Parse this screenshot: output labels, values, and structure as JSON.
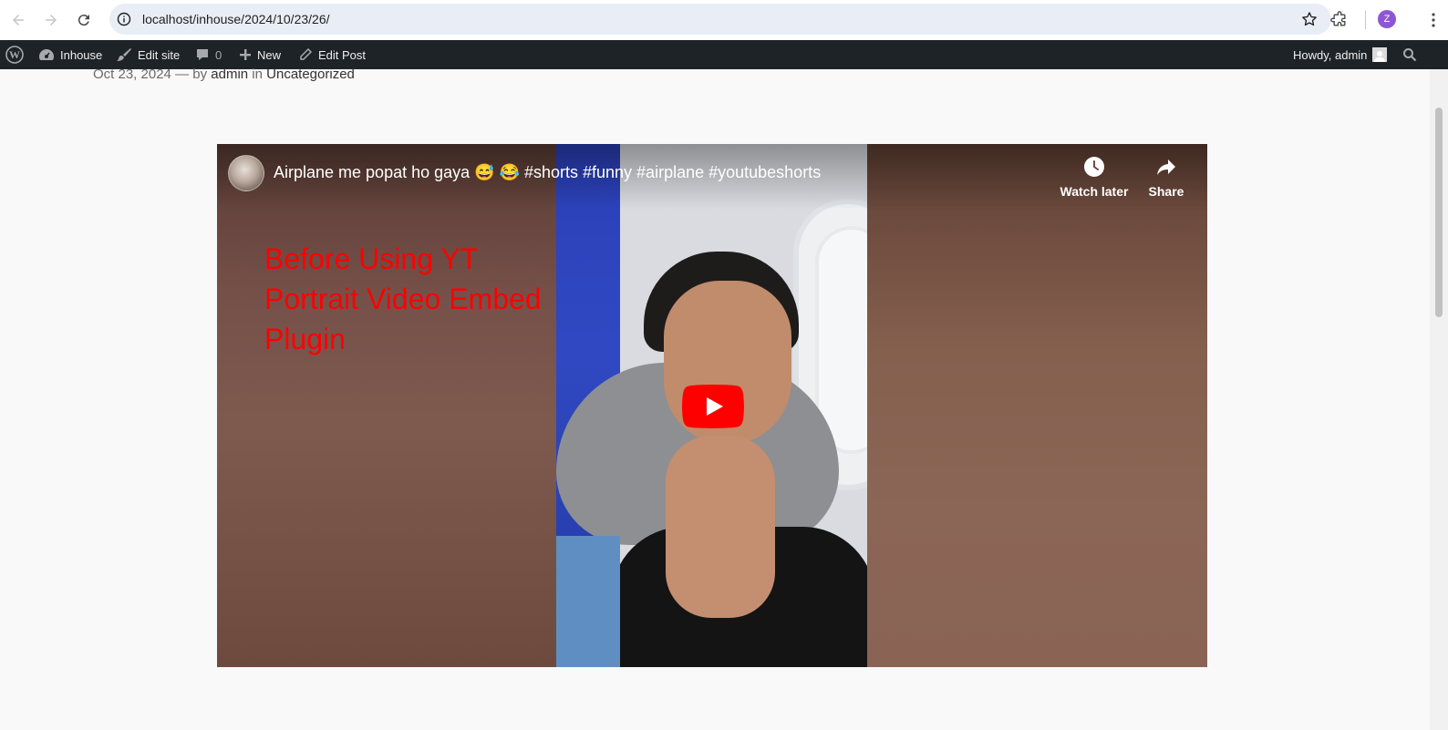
{
  "browser": {
    "url": "localhost/inhouse/2024/10/23/26/",
    "profile_initial": "Z"
  },
  "adminbar": {
    "site_name": "Inhouse",
    "edit_site": "Edit site",
    "comments_count": "0",
    "new_label": "New",
    "edit_post": "Edit Post",
    "howdy": "Howdy, admin"
  },
  "post_meta": {
    "date": "Oct 23, 2024",
    "by_prefix": "— by",
    "author": "admin",
    "in_prefix": "in",
    "category": "Uncategorized"
  },
  "video": {
    "title": "Airplane me popat ho gaya 😅 😂  #shorts #funny #airplane #youtubeshorts",
    "watch_later": "Watch later",
    "share": "Share",
    "overlay_text": "Before Using YT Portrait Video Embed Plugin"
  },
  "colors": {
    "adminbar_bg": "#1d2327",
    "overlay_text": "#ff0000",
    "yt_play": "#ff0000",
    "profile": "#8e56d4"
  }
}
